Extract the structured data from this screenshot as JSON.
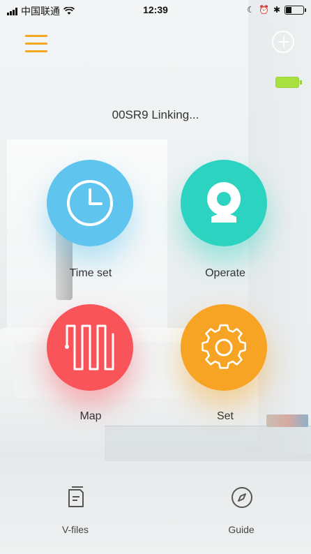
{
  "status_bar": {
    "carrier": "中国联通",
    "time": "12:39"
  },
  "header": {
    "connection_status": "00SR9 Linking..."
  },
  "tiles": [
    {
      "label": "Time set",
      "color": "#5fc5ee",
      "icon": "clock-icon"
    },
    {
      "label": "Operate",
      "color": "#2dd3c1",
      "icon": "camera-icon"
    },
    {
      "label": "Map",
      "color": "#f8545a",
      "icon": "map-path-icon"
    },
    {
      "label": "Set",
      "color": "#f7a425",
      "icon": "gear-icon"
    }
  ],
  "bottom_nav": [
    {
      "label": "V-files",
      "icon": "document-icon"
    },
    {
      "label": "Guide",
      "icon": "compass-icon"
    }
  ],
  "colors": {
    "accent": "#f5a623",
    "battery_indicator": "#a8e040"
  }
}
